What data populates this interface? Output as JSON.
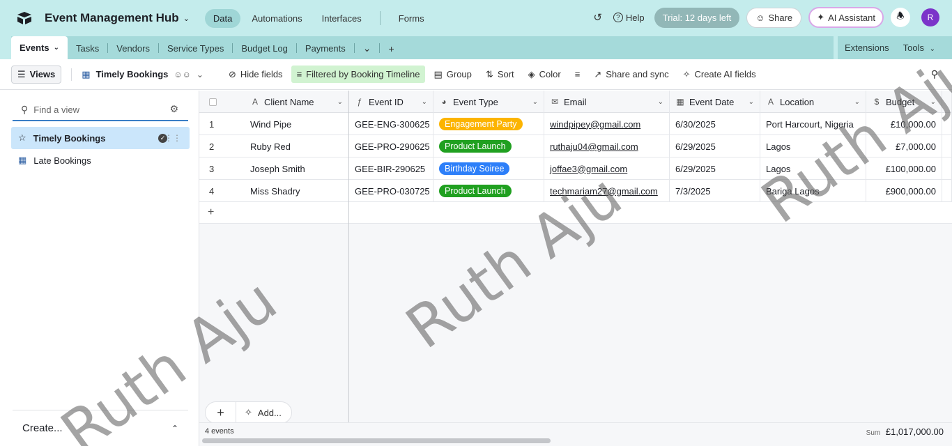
{
  "app": {
    "base_name": "Event Management Hub",
    "nav": [
      "Data",
      "Automations",
      "Interfaces",
      "Forms"
    ],
    "help": "Help",
    "trial": "Trial: 12 days left",
    "share": "Share",
    "ai": "AI Assistant",
    "avatar_initial": "R"
  },
  "tables": {
    "items": [
      "Events",
      "Tasks",
      "Vendors",
      "Service Types",
      "Budget Log",
      "Payments"
    ],
    "extensions": "Extensions",
    "tools": "Tools"
  },
  "toolbar": {
    "views": "Views",
    "current_view": "Timely Bookings",
    "hide_fields": "Hide fields",
    "filter": "Filtered by Booking Timeline",
    "group": "Group",
    "sort": "Sort",
    "color": "Color",
    "share_sync": "Share and sync",
    "create_ai": "Create AI fields"
  },
  "sidebar": {
    "search_placeholder": "Find a view",
    "views": [
      "Timely Bookings",
      "Late Bookings"
    ],
    "create": "Create..."
  },
  "grid": {
    "columns": [
      "Client Name",
      "Event ID",
      "Event Type",
      "Email",
      "Event Date",
      "Location",
      "Budget"
    ],
    "rows": [
      {
        "num": "1",
        "name": "Wind Pipe",
        "id": "GEE-ENG-300625",
        "type": "Engagement Party",
        "type_color": "#fcb400",
        "email": "windpipey@gmail.com",
        "date": "6/30/2025",
        "location": "Port Harcourt, Nigeria",
        "budget": "£10,000.00"
      },
      {
        "num": "2",
        "name": "Ruby Red",
        "id": "GEE-PRO-290625",
        "type": "Product Launch",
        "type_color": "#20a020",
        "email": "ruthaju04@gmail.com",
        "date": "6/29/2025",
        "location": "Lagos",
        "budget": "£7,000.00"
      },
      {
        "num": "3",
        "name": "Joseph Smith",
        "id": "GEE-BIR-290625",
        "type": "Birthday Soiree",
        "type_color": "#2d7ff9",
        "email": "joffae3@gmail.com",
        "date": "6/29/2025",
        "location": "Lagos",
        "budget": "£100,000.00"
      },
      {
        "num": "4",
        "name": "Miss Shadry",
        "id": "GEE-PRO-030725",
        "type": "Product Launch",
        "type_color": "#20a020",
        "email": "techmariam27@gmail.com",
        "date": "7/3/2025",
        "location": "Bariga Lagos",
        "budget": "£900,000.00"
      }
    ],
    "add_label": "Add...",
    "record_count": "4 events",
    "sum_label": "Sum",
    "sum_value": "£1,017,000.00"
  },
  "watermark": "Ruth Aju"
}
